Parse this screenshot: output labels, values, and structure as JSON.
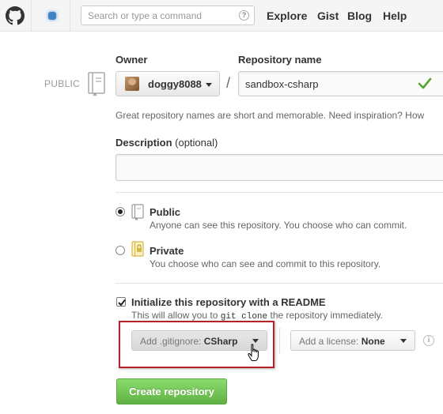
{
  "header": {
    "search_placeholder": "Search or type a command",
    "search_help": "?",
    "nav": [
      "Explore",
      "Gist",
      "Blog",
      "Help"
    ]
  },
  "form": {
    "owner_label": "Owner",
    "repo_name_label": "Repository name",
    "visibility_badge": "PUBLIC",
    "owner_name": "doggy8088",
    "separator": "/",
    "repo_name_value": "sandbox-csharp",
    "hint": "Great repository names are short and memorable. Need inspiration? How",
    "description_label": "Description",
    "description_optional": "(optional)",
    "description_value": "",
    "public_title": "Public",
    "public_desc": "Anyone can see this repository. You choose who can commit.",
    "private_title": "Private",
    "private_desc": "You choose who can see and commit to this repository.",
    "selected_visibility": "Public",
    "init_readme_label": "Initialize this repository with a README",
    "init_readme_checked": true,
    "init_desc_before": "This will allow you to",
    "init_desc_code": "git clone",
    "init_desc_after": "the repository immediately.",
    "gitignore_prefix": "Add .gitignore:",
    "gitignore_value": "CSharp",
    "license_prefix": "Add a license:",
    "license_value": "None",
    "info": "i",
    "create_button": "Create repository"
  },
  "colors": {
    "accent_green": "#60b044",
    "highlight_red": "#b82128",
    "link_blue": "#4183c4"
  }
}
